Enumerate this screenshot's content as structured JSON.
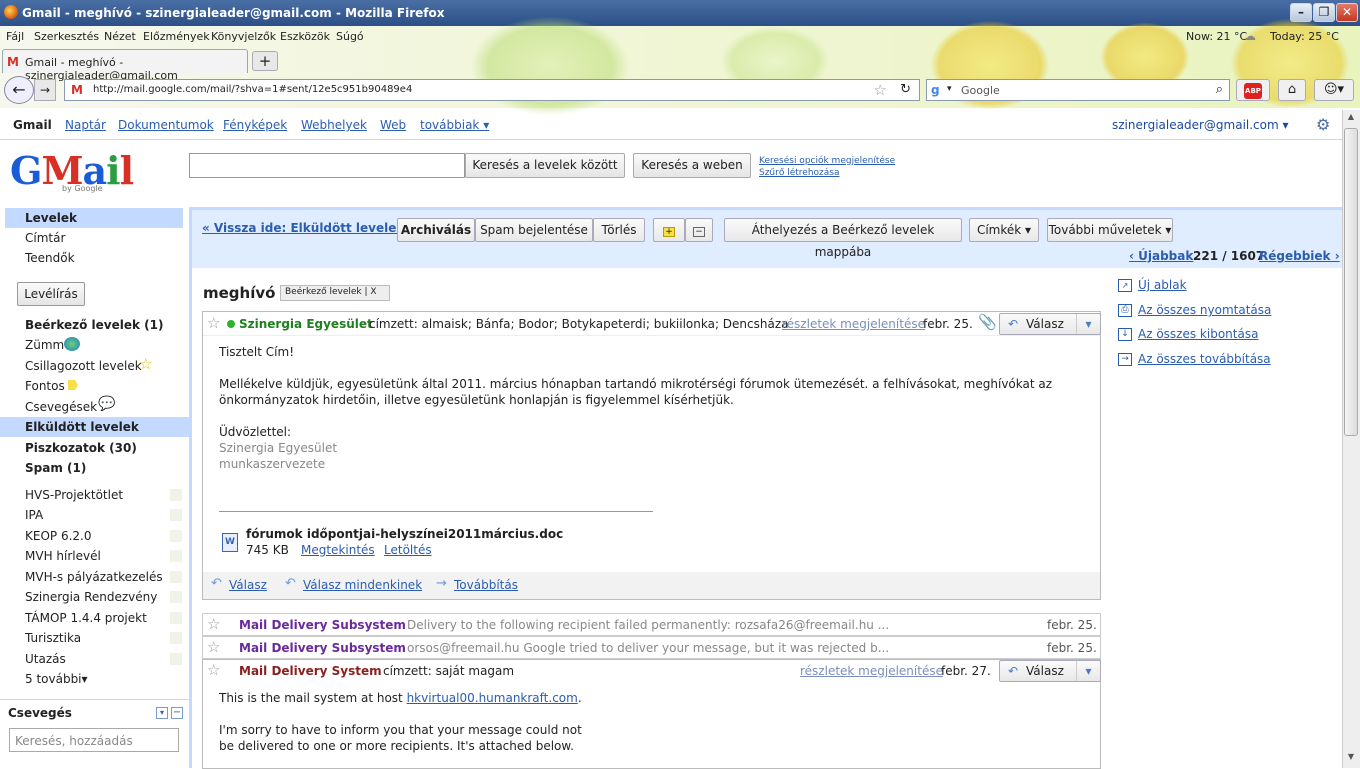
{
  "window": {
    "title": "Gmail - meghívó - szinergialeader@gmail.com - Mozilla Firefox"
  },
  "menu": [
    "Fájl",
    "Szerkesztés",
    "Nézet",
    "Előzmények",
    "Könyvjelzők",
    "Eszközök",
    "Súgó"
  ],
  "weather": {
    "now": "Now: 21 °C",
    "today": "Today: 25 °C"
  },
  "tab": {
    "title": "Gmail - meghívó - szinergialeader@gmail.com",
    "new": "+"
  },
  "address": {
    "url": "http://mail.google.com/mail/?shva=1#sent/12e5c951b90489e4"
  },
  "searchbar": {
    "placeholder": "Google"
  },
  "gbar": {
    "items": [
      "Gmail",
      "Naptár",
      "Dokumentumok",
      "Fényképek",
      "Webhelyek",
      "Web",
      "továbbiak ▾"
    ],
    "account": "szinergialeader@gmail.com ▾"
  },
  "logo": {
    "text": "GMail",
    "by": "by Google"
  },
  "search": {
    "mail_btn": "Keresés a levelek között",
    "web_btn": "Keresés a weben",
    "opt1": "Keresési opciók megjelenítése",
    "opt2": "Szűrő létrehozása"
  },
  "nav": {
    "top": [
      "Levelek",
      "Címtár",
      "Teendők"
    ],
    "compose": "Levélírás",
    "folders": [
      "Beérkező levelek (1)",
      "Zümm",
      "Csillagozott levelek",
      "Fontos",
      "Csevegések",
      "Elküldött levelek",
      "Piszkozatok (30)",
      "Spam (1)"
    ],
    "labels": [
      "HVS-Projektötlet",
      "IPA",
      "KEOP 6.2.0",
      "MVH hírlevél",
      "MVH-s pályázatkezelés",
      "Szinergia Rendezvény",
      "TÁMOP 1.4.4 projekt",
      "Turisztika",
      "Utazás",
      "5 további▾"
    ],
    "chat_title": "Csevegés",
    "chat_placeholder": "Keresés, hozzáadás"
  },
  "toolbar": {
    "back": "« Vissza ide: Elküldött levelek",
    "archive": "Archiválás",
    "spam": "Spam bejelentése",
    "delete": "Törlés",
    "move": "Áthelyezés a Beérkező levelek mappába",
    "labels": "Címkék ▾",
    "more": "További műveletek ▾",
    "newer": "‹ Újabbak",
    "count": "221 / 1607",
    "older": "Régebbiek ›"
  },
  "thread": {
    "subject": "meghívó",
    "label": "Beérkező levelek | X"
  },
  "msg1": {
    "sender": "Szinergia Egyesület",
    "to": "címzett: almaisk; Bánfa; Bodor; Botykapeterdi; bukiilonka; Dencsháza",
    "details": "részletek megjelenítése",
    "date": "febr. 25.",
    "reply": "Válasz",
    "greeting": "Tisztelt Cím!",
    "body1": "Mellékelve küldjük, egyesületünk által 2011. március hónapban tartandó mikrotérségi fórumok ütemezését. a felhívásokat, meghívókat az",
    "body2": "önkormányzatok hirdetőin, illetve egyesületünk honlapján is figyelemmel kísérhetjük.",
    "sign1": "Üdvözlettel:",
    "sign2": "Szinergia Egyesület",
    "sign3": "munkaszervezete",
    "att_name": "fórumok időpontjai-helyszínei2011március.doc",
    "att_size": "745 KB",
    "att_view": "Megtekintés",
    "att_dl": "Letöltés",
    "act_reply": "Válasz",
    "act_reply_all": "Válasz mindenkinek",
    "act_forward": "Továbbítás"
  },
  "rows": [
    {
      "sender": "Mail Delivery Subsystem",
      "snippet": "Delivery to the following recipient failed permanently: rozsafa26@freemail.hu ...",
      "date": "febr. 25."
    },
    {
      "sender": "Mail Delivery Subsystem",
      "snippet": "orsos@freemail.hu Google tried to deliver your message, but it was rejected b...",
      "date": "febr. 25."
    }
  ],
  "msg3": {
    "sender": "Mail Delivery System",
    "to": "címzett: saját magam",
    "details": "részletek megjelenítése",
    "date": "febr. 27.",
    "reply": "Válasz",
    "line1": "This is the mail system at host ",
    "host": "hkvirtual00.humankraft.com",
    "line1end": ".",
    "line2": "I'm sorry to have to inform you that your message could not",
    "line3": "be delivered to one or more recipients. It's attached below."
  },
  "right": [
    "Új ablak",
    "Az összes nyomtatása",
    "Az összes kibontása",
    "Az összes továbbítása"
  ],
  "colors": {
    "accent": "#2a5db0",
    "nav_selected": "#c3d9ff",
    "toolbar": "#e0ecff",
    "sender_sys": "#6a2a9a"
  }
}
